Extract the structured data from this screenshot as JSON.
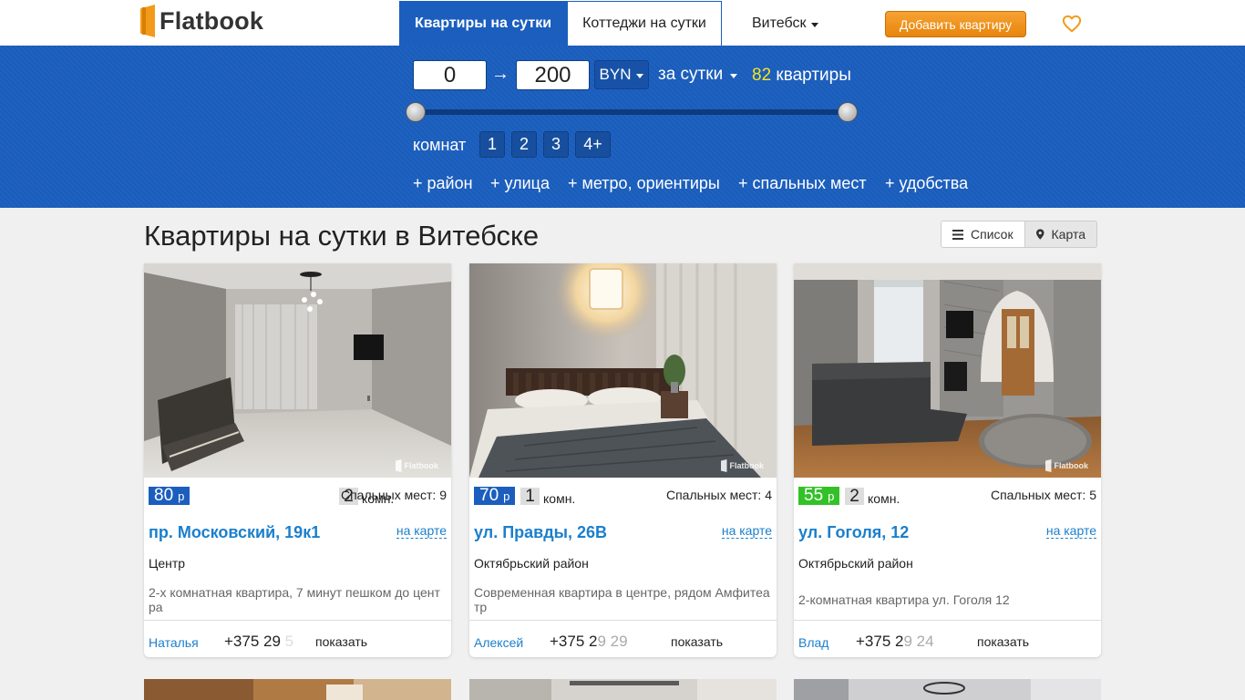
{
  "header": {
    "logo_text": "Flatbook",
    "tab_apartments": "Квартиры на сутки",
    "tab_cottages": "Коттеджи на сутки",
    "city": "Витебск",
    "add_button": "Добавить квартиру"
  },
  "filter": {
    "price_min": "0",
    "price_max": "200",
    "arrow": "→",
    "currency": "BYN",
    "period": "за сутки",
    "count_num": "82",
    "count_text": "квартиры",
    "rooms_label": "комнат",
    "rooms": [
      "1",
      "2",
      "3",
      "4+"
    ],
    "more": [
      "+ район",
      "+ улица",
      "+ метро, ориентиры",
      "+ спальных мест",
      "+ удобства"
    ]
  },
  "page": {
    "title": "Квартиры на сутки в Витебске",
    "view_list": "Список",
    "view_map": "Карта"
  },
  "listings": [
    {
      "price": "80",
      "price_currency": "р",
      "price_color": "#1b5ebe",
      "rooms": "2",
      "rooms_suffix": "комн.",
      "beds": "Спальных мест: 9",
      "address": "пр. Московский, 19к1",
      "map_link": "на карте",
      "district": "Центр",
      "description": "2-х комнатная квартира, 7 минут пешком до центра",
      "owner": "Наталья",
      "phone_visible": "+375 29",
      "phone_fade": "5",
      "show": "показать",
      "watermark": "Flatbook"
    },
    {
      "price": "70",
      "price_currency": "р",
      "price_color": "#1b5ebe",
      "rooms": "1",
      "rooms_suffix": "комн.",
      "beds": "Спальных мест: 4",
      "address": "ул. Правды, 26В",
      "map_link": "на карте",
      "district": "Октябрьский район",
      "description": "Современная квартира в центре, рядом Амфитеатр",
      "owner": "Алексей",
      "phone_visible": "+375 2",
      "phone_fade": "9 29",
      "show": "показать",
      "watermark": "Flatbook"
    },
    {
      "price": "55",
      "price_currency": "р",
      "price_color": "#33c128",
      "rooms": "2",
      "rooms_suffix": "комн.",
      "beds": "Спальных мест: 5",
      "address": "ул. Гоголя, 12",
      "map_link": "на карте",
      "district": "Октябрьский район",
      "description": "2-комнатная квартира ул. Гоголя 12",
      "owner": "Влад",
      "phone_visible": "+375 2",
      "phone_fade": "9 24",
      "show": "показать",
      "watermark": "Flatbook"
    }
  ]
}
